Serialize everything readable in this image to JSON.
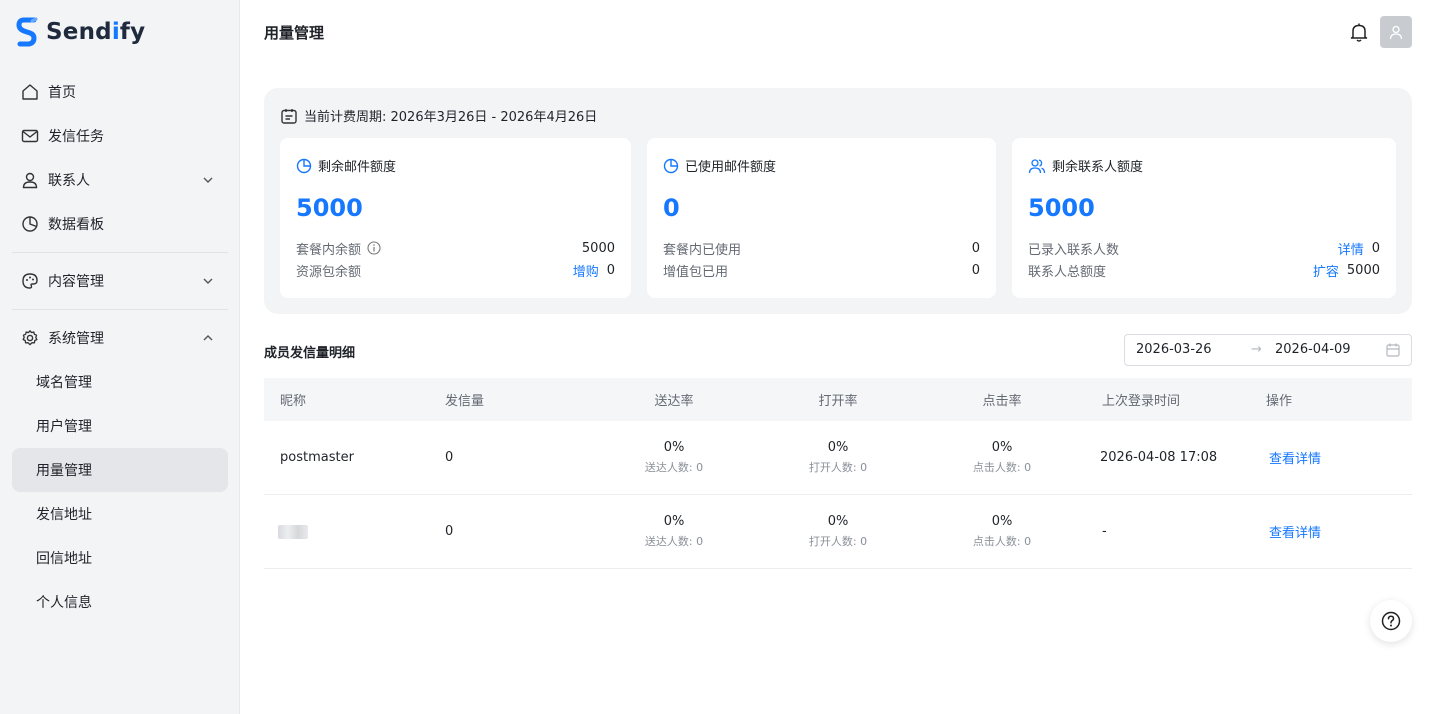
{
  "brand": {
    "name_prefix": "Send",
    "name_i": "i",
    "name_suffix": "fy"
  },
  "sidebar": {
    "home": "首页",
    "tasks": "发信任务",
    "contacts": "联系人",
    "dashboard": "数据看板",
    "content": "内容管理",
    "system": "系统管理",
    "sub": {
      "domain": "域名管理",
      "users": "用户管理",
      "usage": "用量管理",
      "sender": "发信地址",
      "reply": "回信地址",
      "profile": "个人信息"
    }
  },
  "header": {
    "title": "用量管理"
  },
  "billing": {
    "period": "当前计费周期: 2026年3月26日 - 2026年4月26日",
    "cards": [
      {
        "title": "剩余邮件额度",
        "value": "5000",
        "row1_label": "套餐内余额",
        "row1_value": "5000",
        "row2_label": "资源包余额",
        "row2_link": "增购",
        "row2_value": "0"
      },
      {
        "title": "已使用邮件额度",
        "value": "0",
        "row1_label": "套餐内已使用",
        "row1_value": "0",
        "row2_label": "增值包已用",
        "row2_value": "0"
      },
      {
        "title": "剩余联系人额度",
        "value": "5000",
        "row1_label": "已录入联系人数",
        "row1_link": "详情",
        "row1_value": "0",
        "row2_label": "联系人总额度",
        "row2_link": "扩容",
        "row2_value": "5000"
      }
    ]
  },
  "members": {
    "title": "成员发信量明细",
    "date_start": "2026-03-26",
    "date_arrow": "→",
    "date_end": "2026-04-09",
    "columns": [
      "昵称",
      "发信量",
      "送达率",
      "打开率",
      "点击率",
      "上次登录时间",
      "操作"
    ],
    "rows": [
      {
        "nickname": "postmaster",
        "sent": "0",
        "delivery": "0%",
        "delivery_sub": "送达人数: 0",
        "open": "0%",
        "open_sub": "打开人数: 0",
        "click": "0%",
        "click_sub": "点击人数: 0",
        "last_login": "2026-04-08 17:08",
        "action": "查看详情"
      },
      {
        "nickname": "",
        "sent": "0",
        "delivery": "0%",
        "delivery_sub": "送达人数: 0",
        "open": "0%",
        "open_sub": "打开人数: 0",
        "click": "0%",
        "click_sub": "点击人数: 0",
        "last_login": "-",
        "action": "查看详情"
      }
    ]
  },
  "colors": {
    "accent": "#1677ff",
    "sidebar_bg": "#f3f4f6",
    "active_bg": "#e4e6ea"
  }
}
